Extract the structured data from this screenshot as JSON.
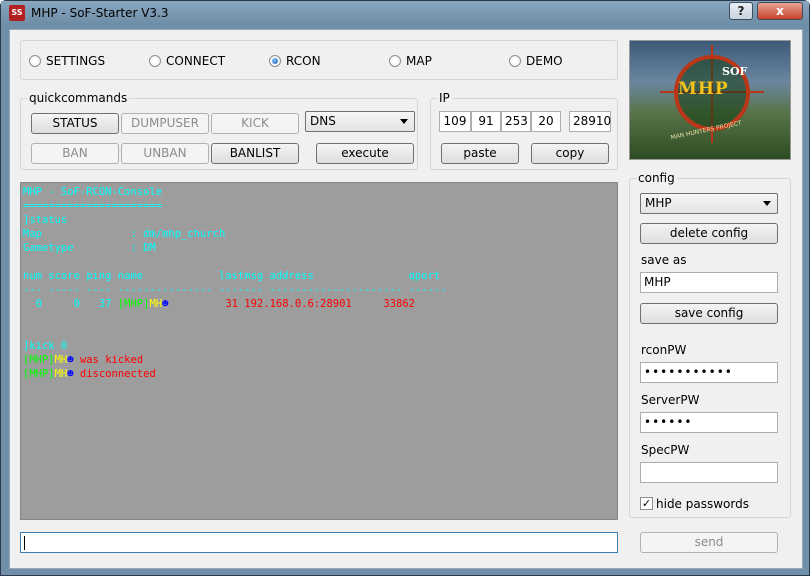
{
  "window": {
    "title": "MHP - SoF-Starter V3.3",
    "app_icon_text": "SS",
    "help_glyph": "?",
    "close_glyph": "x"
  },
  "tabs": [
    {
      "label": "SETTINGS",
      "checked": false
    },
    {
      "label": "CONNECT",
      "checked": false
    },
    {
      "label": "RCON",
      "checked": true
    },
    {
      "label": "MAP",
      "checked": false
    },
    {
      "label": "DEMO",
      "checked": false
    }
  ],
  "quickcommands": {
    "title": "quickcommands",
    "status": "STATUS",
    "dumpuser": "DUMPUSER",
    "kick": "KICK",
    "ban": "BAN",
    "unban": "UNBAN",
    "banlist": "BANLIST",
    "select_value": "DNS",
    "execute": "execute"
  },
  "ip": {
    "title": "IP",
    "octet1": "109",
    "octet2": "91",
    "octet3": "253",
    "octet4": "20",
    "port": "28910",
    "paste": "paste",
    "copy": "copy"
  },
  "logo": {
    "text": "MHP",
    "badge": "SOF",
    "subtitle": "MAN HUNTERS PROJECT"
  },
  "config": {
    "title": "config",
    "selected": "MHP",
    "delete_label": "delete config",
    "save_as_label": "save as",
    "save_as_value": "MHP",
    "save_label": "save config",
    "rcon_label": "rconPW",
    "rcon_value": "•••••••••••",
    "server_label": "ServerPW",
    "server_value": "••••••",
    "spec_label": "SpecPW",
    "spec_value": "",
    "hide_label": "hide passwords",
    "hide_checked": "✓"
  },
  "console": {
    "line1": "MHP - SoF-RCON-Console",
    "line2": "======================",
    "line3": "]status",
    "line4": "Map              : dm/mhp_church",
    "line5": "Gametype         : DM",
    "line6": "num score ping name            lastmsg address               qport",
    "line7": "--- ----- ---- --------------- ------- --------------------- ------",
    "row_prefix": "  0     0   37 ",
    "row_tag": "[MHP]",
    "row_name": "MH",
    "row_rest": "         31 192.168.0.6:28901     33862",
    "line9": "]kick 0",
    "kicked_tag": "[MHP]",
    "kicked_name": "MH",
    "kicked_text": " was kicked",
    "disc_tag": "[MHP]",
    "disc_name": "MH",
    "disc_text": " disconnected",
    "smiley": "☻"
  },
  "command": {
    "value": "",
    "send_label": "send"
  }
}
